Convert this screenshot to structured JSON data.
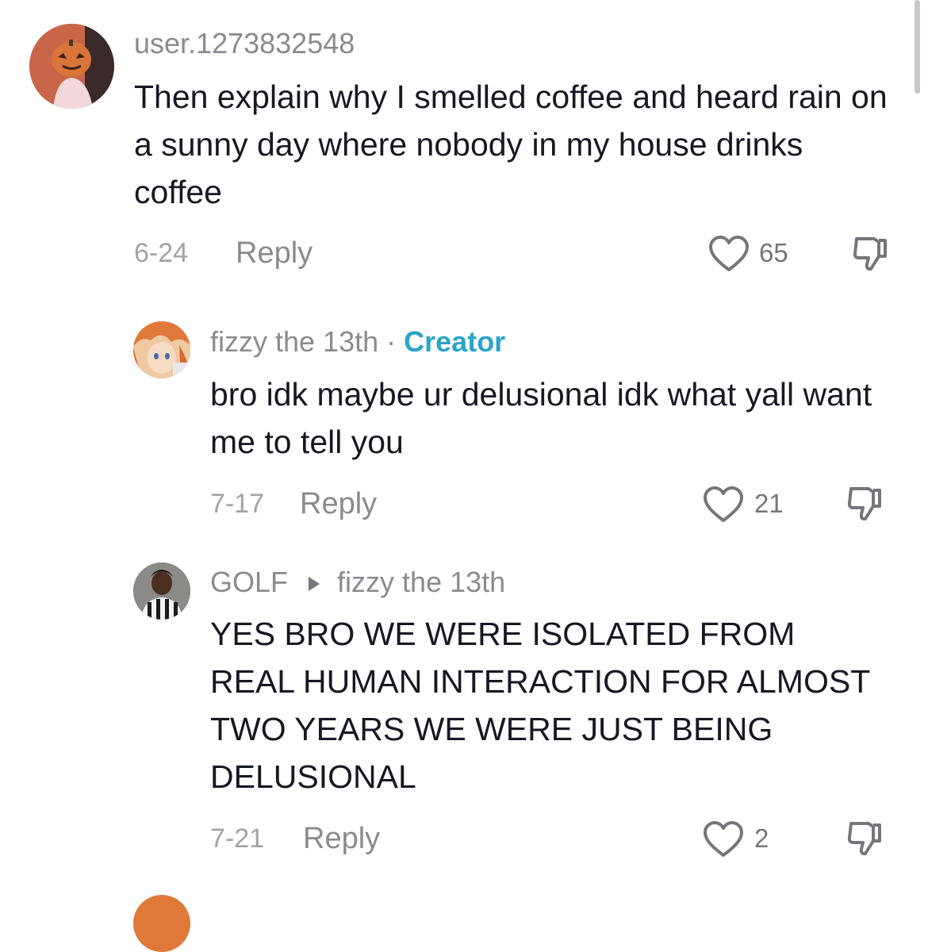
{
  "comments": [
    {
      "username": "user.1273832548",
      "text": "Then explain why I smelled coffee and heard rain on a sunny day where nobody in my house drinks coffee",
      "date": "6-24",
      "reply_label": "Reply",
      "likes": "65"
    },
    {
      "username": "fizzy the 13th",
      "separator": "·",
      "badge": "Creator",
      "text": "bro idk maybe ur delusional idk what yall want me to tell you",
      "date": "7-17",
      "reply_label": "Reply",
      "likes": "21"
    },
    {
      "username": "GOLF",
      "reply_to": "fizzy the 13th",
      "text": "YES BRO WE WERE ISOLATED FROM REAL HUMAN INTERACTION FOR ALMOST TWO YEARS WE WERE JUST BEING DELUSIONAL",
      "date": "7-21",
      "reply_label": "Reply",
      "likes": "2"
    }
  ],
  "icons": {
    "like": "heart-outline-icon",
    "dislike": "thumbs-down-outline-icon",
    "reply_arrow": "play-triangle-icon"
  },
  "colors": {
    "creator_badge": "#2aa4c8",
    "username": "#8a8b91",
    "meta": "#a1a2a7"
  }
}
